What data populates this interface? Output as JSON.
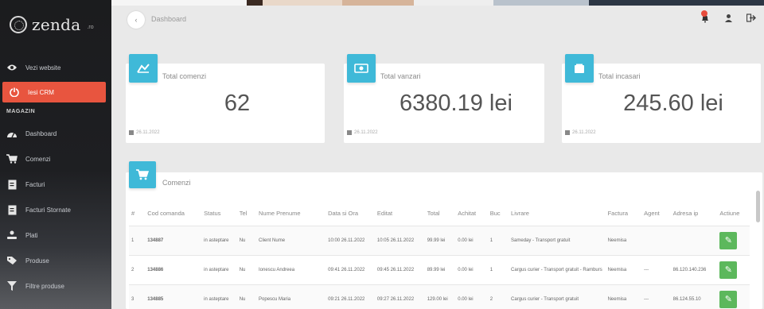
{
  "app": {
    "logo_text": "zenda",
    "logo_suffix": ".ro"
  },
  "header": {
    "breadcrumb": "Dashboard"
  },
  "sidebar": {
    "section_label": "MAGAZIN",
    "items": [
      {
        "label": "Vezi website",
        "icon": "eye-icon"
      },
      {
        "label": "Iesi CRM",
        "icon": "logout-icon",
        "active": true
      },
      {
        "label": "Dashboard",
        "icon": "dashboard-icon"
      },
      {
        "label": "Comenzi",
        "icon": "cart-icon"
      },
      {
        "label": "Facturi",
        "icon": "invoice-icon"
      },
      {
        "label": "Facturi Stornate",
        "icon": "invoice-storno-icon"
      },
      {
        "label": "Plati",
        "icon": "payment-icon"
      },
      {
        "label": "Produse",
        "icon": "tags-icon"
      },
      {
        "label": "Filtre produse",
        "icon": "filter-icon"
      }
    ]
  },
  "stats": [
    {
      "label": "Total comenzi",
      "value": "62",
      "date": "26.11.2022",
      "icon": "bar-chart-icon"
    },
    {
      "label": "Total vanzari",
      "value": "6380.19 lei",
      "date": "26.11.2022",
      "icon": "money-icon"
    },
    {
      "label": "Total incasari",
      "value": "245.60 lei",
      "date": "26.11.2022",
      "icon": "wallet-icon"
    }
  ],
  "orders": {
    "title": "Comenzi",
    "columns": [
      "#",
      "Cod comanda",
      "Status",
      "Tel",
      "Nume Prenume",
      "Data si Ora",
      "Editat",
      "Total",
      "Achitat",
      "Buc",
      "Livrare",
      "Factura",
      "Agent",
      "Adresa ip",
      "Actiune"
    ],
    "rows": [
      {
        "num": "1",
        "code": "134887",
        "status": "in asteptare",
        "tel": "Nu",
        "name": "Client Nume",
        "date": "10:00 26.11.2022",
        "edited": "10:05 26.11.2022",
        "total": "99.99 lei",
        "paid": "0.00 lei",
        "qty": "1",
        "delivery": "Sameday - Transport gratuit",
        "invoice": "Neemisa",
        "agent": "",
        "ip": ""
      },
      {
        "num": "2",
        "code": "134886",
        "status": "in asteptare",
        "tel": "Nu",
        "name": "Ionescu Andreea",
        "date": "09:41 26.11.2022",
        "edited": "09:45 26.11.2022",
        "total": "89.99 lei",
        "paid": "0.00 lei",
        "qty": "1",
        "delivery": "Cargus curier - Transport gratuit - Ramburs",
        "invoice": "Neemisa",
        "agent": "---",
        "ip": "86.120.140.236"
      },
      {
        "num": "3",
        "code": "134885",
        "status": "in asteptare",
        "tel": "Nu",
        "name": "Popescu Maria",
        "date": "09:21 26.11.2022",
        "edited": "09:27 26.11.2022",
        "total": "129.00 lei",
        "paid": "0.00 lei",
        "qty": "2",
        "delivery": "Cargus curier - Transport gratuit",
        "invoice": "Neemisa",
        "agent": "---",
        "ip": "86.124.55.10"
      }
    ],
    "edit_icon": "edit-icon"
  },
  "colors": {
    "accent": "#e8553f",
    "badge": "#3fb9d8",
    "edit": "#5cb85c",
    "sidebar_bg": "#1d1e21"
  }
}
